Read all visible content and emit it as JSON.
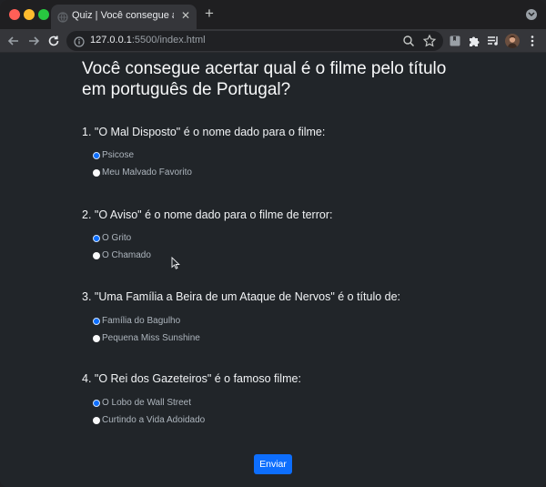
{
  "browser": {
    "tab_title": "Quiz | Você consegue acertar qual é o filme pelo título em português de Portugal?",
    "url_scheme_host": "127.0.0.1",
    "url_rest": ":5500/index.html",
    "icons": {
      "back": "arrow-left-icon",
      "forward": "arrow-right-icon",
      "reload": "reload-icon",
      "site_info": "info-icon",
      "zoom": "zoom-icon",
      "bookmark": "star-icon",
      "extension1": "bookmark-extension-icon",
      "extensions": "puzzle-icon",
      "media": "media-control-icon",
      "menu": "kebab-menu-icon"
    }
  },
  "page": {
    "title": "Você consegue acertar qual é o filme pelo título em português de Portugal?",
    "questions": [
      {
        "text": "1. \"O Mal Disposto\" é o nome dado para o filme:",
        "options": [
          {
            "label": "Psicose",
            "checked": true
          },
          {
            "label": "Meu Malvado Favorito",
            "checked": false
          }
        ]
      },
      {
        "text": "2. \"O Aviso\" é o nome dado para o filme de terror:",
        "options": [
          {
            "label": "O Grito",
            "checked": true
          },
          {
            "label": "O Chamado",
            "checked": false
          }
        ]
      },
      {
        "text": "3. \"Uma Família a Beira de um Ataque de Nervos\" é o título de:",
        "options": [
          {
            "label": "Família do Bagulho",
            "checked": true
          },
          {
            "label": "Pequena Miss Sunshine",
            "checked": false
          }
        ]
      },
      {
        "text": "4. \"O Rei dos Gazeteiros\" é o famoso filme:",
        "options": [
          {
            "label": "O Lobo de Wall Street",
            "checked": true
          },
          {
            "label": "Curtindo a Vida Adoidado",
            "checked": false
          }
        ]
      }
    ],
    "submit_label": "Enviar"
  },
  "colors": {
    "page_bg": "#212529",
    "accent": "#0d6efd",
    "text": "#f1f3f5",
    "muted_text": "#adb5bd"
  }
}
